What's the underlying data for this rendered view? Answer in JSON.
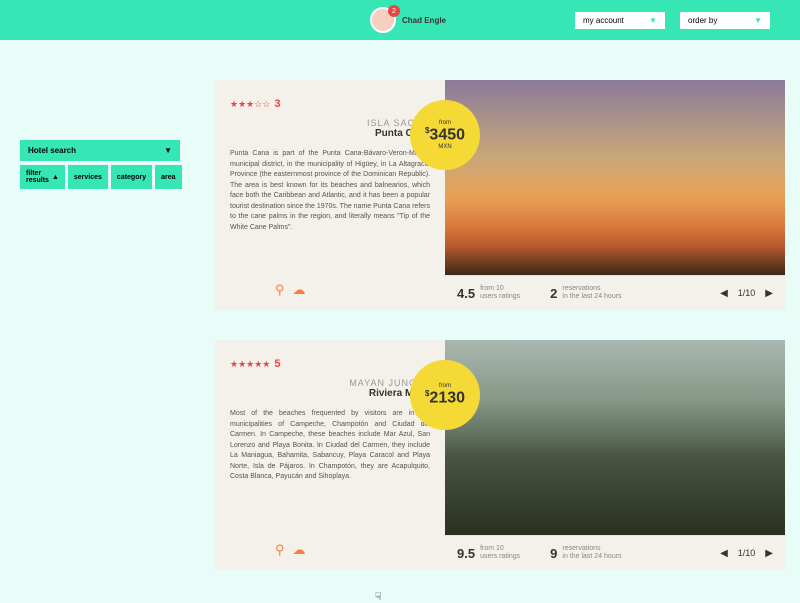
{
  "header": {
    "user": {
      "name": "Chad Engle",
      "notifications": "2"
    },
    "myAccount": "my account",
    "orderBy": "order by"
  },
  "sidebar": {
    "search": "Hotel search",
    "filter": "filter results",
    "btns": [
      "services",
      "category",
      "area"
    ]
  },
  "cards": [
    {
      "stars": "★★★☆☆",
      "score": "3",
      "location": "ISLA SAONA",
      "dest": "Punta Cana",
      "desc": "Punta Cana is part of the Punta Cana-Bávaro-Veron-Macao municipal district, in the municipality of Higüey, in La Altagracia Province (the easternmost province of the Dominican Republic). The area is best known for its beaches and balnearios, which face both the Caribbean and Atlantic, and it has been a popular tourist destination since the 1970s. The name Punta Cana refers to the cane palms in the region, and literally means \"Tip of the White Cane Palms\".",
      "price": {
        "from": "from",
        "amount": "3450",
        "currency": "MXN"
      },
      "rating": {
        "val": "4.5",
        "of": "from 10",
        "lab": "users ratings"
      },
      "resv": {
        "val": "2",
        "lab1": "reservations",
        "lab2": "in the last 24 hours"
      },
      "page": "1/10"
    },
    {
      "stars": "★★★★★",
      "score": "5",
      "location": "MAYAN JUNGLE",
      "dest": "Riviera Maya",
      "desc": "Most of the beaches frequented by visitors are in the municipalities of Campeche, Champotón and Ciudad del Carmen. In Campeche, these beaches include Mar Azul, San Lorenzo and Playa Bonita. In Ciudad del Carmen, they include La Maniagua, Bahamita, Sabancuy, Playa Caracol and Playa Norte, Isla de Pájaros. In Champotón, they are Acapulquito, Costa Blanca, Payucán and Sihoplaya.",
      "price": {
        "from": "from",
        "amount": "2130",
        "currency": ""
      },
      "rating": {
        "val": "9.5",
        "of": "from 10",
        "lab": "users ratings"
      },
      "resv": {
        "val": "9",
        "lab1": "reservations",
        "lab2": "in the last 24 hours"
      },
      "page": "1/10"
    }
  ]
}
